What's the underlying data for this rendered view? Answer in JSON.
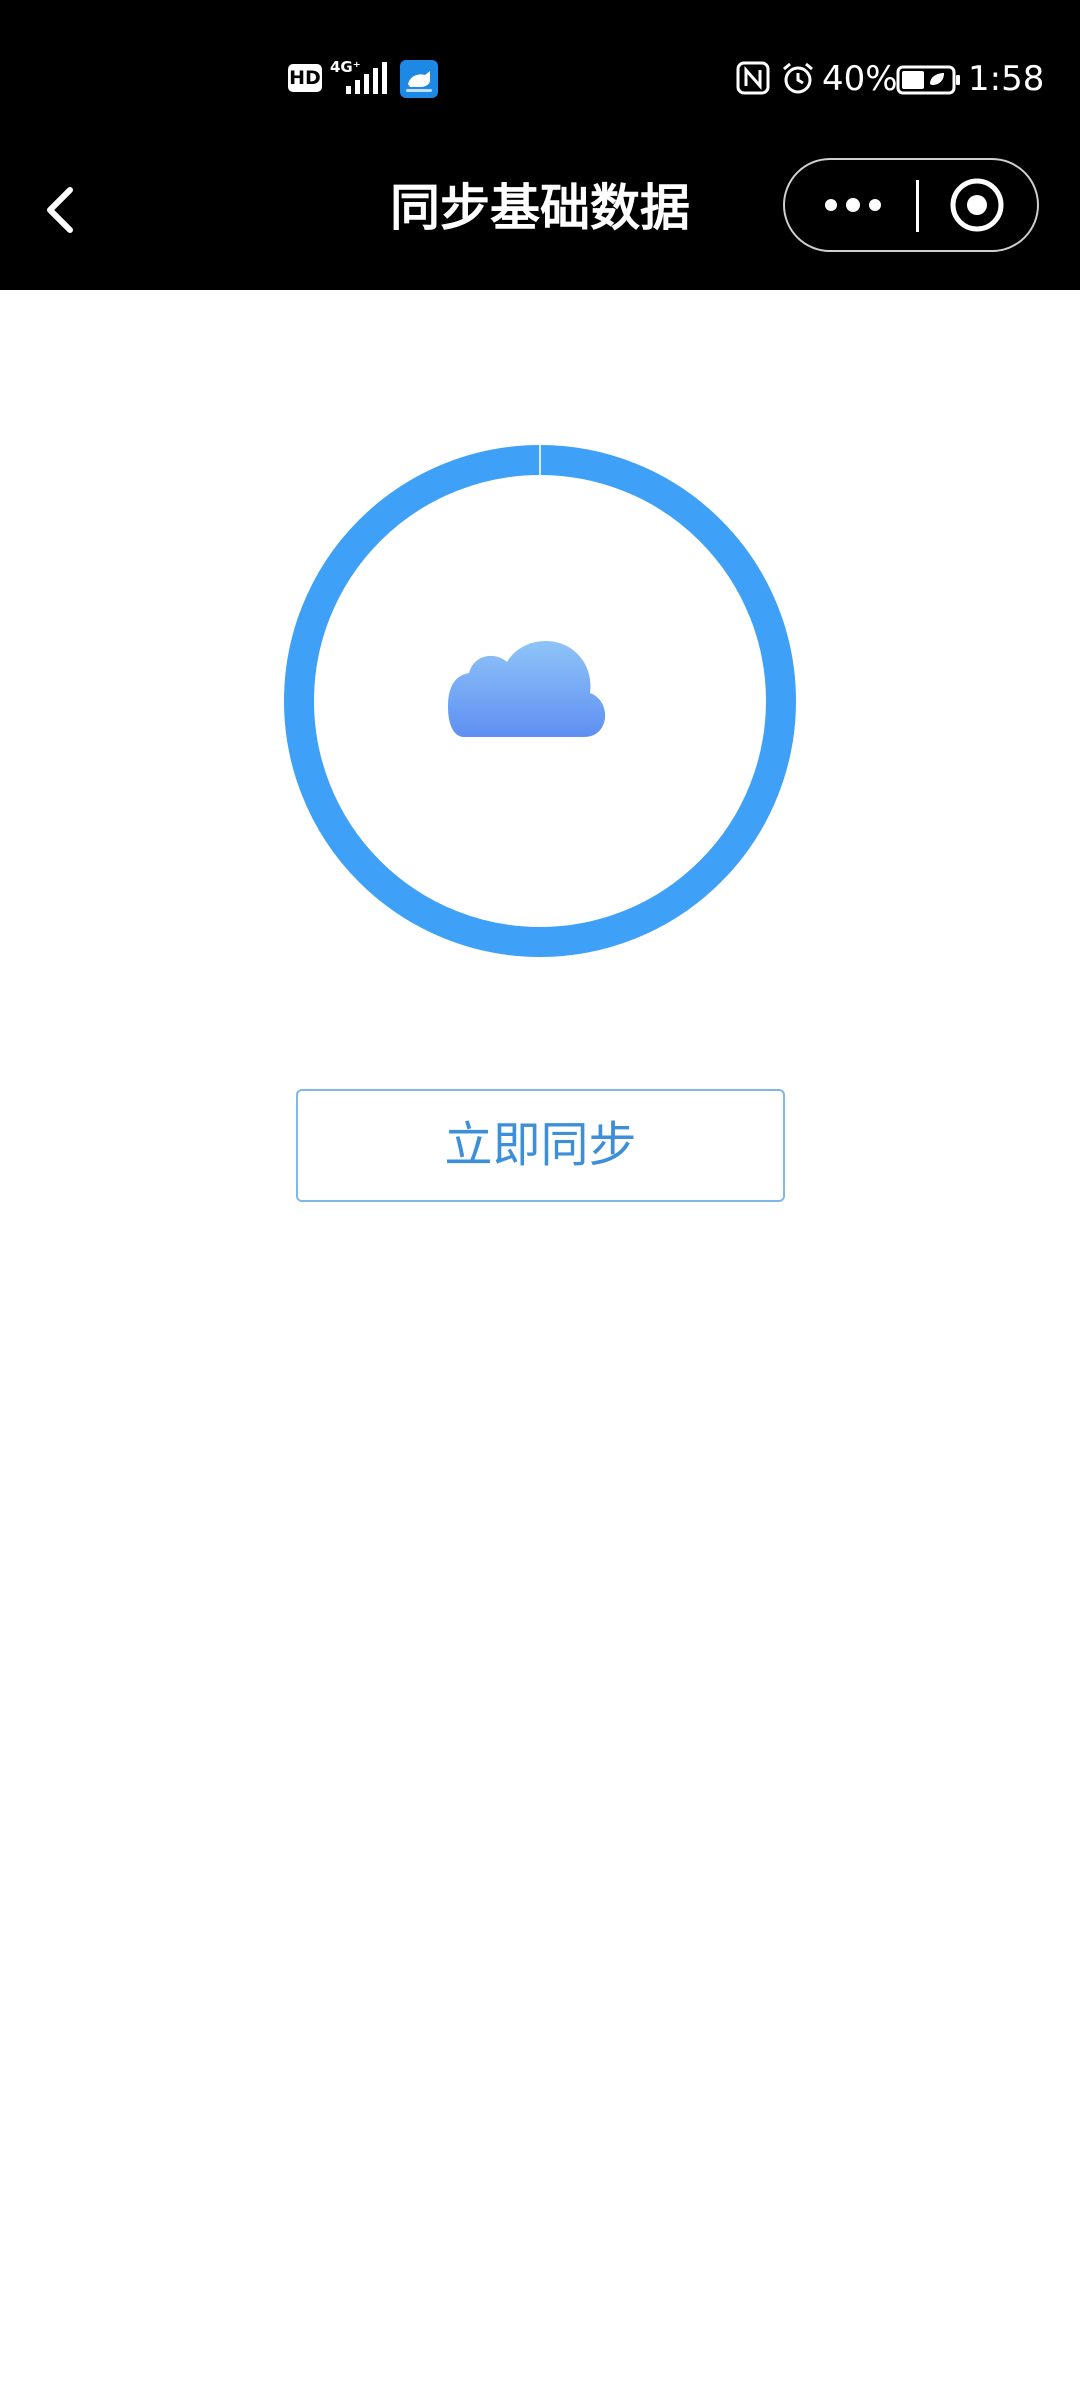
{
  "status_bar": {
    "hd_label": "HD",
    "network_label": "4G⁺",
    "battery_percent": "40%",
    "time": "1:58",
    "icons": [
      "hd-icon",
      "signal-icon",
      "app-notification-icon",
      "nfc-icon",
      "alarm-icon",
      "battery-icon"
    ]
  },
  "nav": {
    "title": "同步基础数据",
    "back_icon": "chevron-left-icon",
    "more_icon": "more-dots-icon",
    "close_icon": "target-close-icon"
  },
  "main": {
    "sync_progress": 1.0,
    "cloud_icon": "cloud-icon",
    "sync_button_label": "立即同步"
  },
  "colors": {
    "ring": "#3ea0f6",
    "cloud_top": "#8fc4f8",
    "cloud_bottom": "#5f8ff2",
    "button_text": "#3d8fd9",
    "button_border": "#7fb8e6",
    "header_bg": "#000000"
  }
}
